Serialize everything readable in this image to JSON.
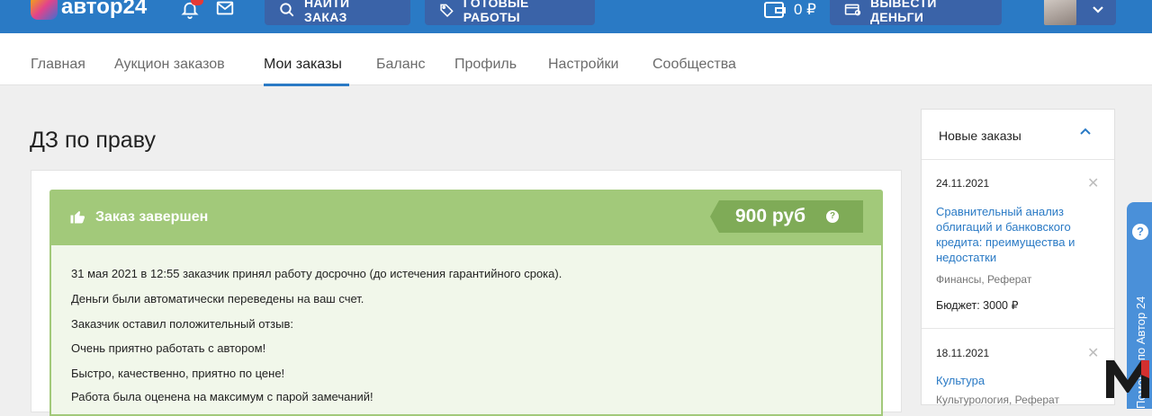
{
  "header": {
    "logo_text": "автор24",
    "find_order_label": "НАЙТИ ЗАКАЗ",
    "ready_works_label": "ГОТОВЫЕ РАБОТЫ",
    "balance": "0 ₽",
    "withdraw_label": "ВЫВЕСТИ ДЕНЬГИ",
    "brand_color": "#2a7ac5"
  },
  "nav": {
    "items": [
      "Главная",
      "Аукцион заказов",
      "Мои заказы",
      "Баланс",
      "Профиль",
      "Настройки",
      "Сообщества"
    ],
    "active": "Мои заказы"
  },
  "page": {
    "title": "ДЗ по праву"
  },
  "status": {
    "label": "Заказ завершен",
    "price": "900 руб",
    "help": "?",
    "lines": [
      "31 мая 2021 в 12:55 заказчик принял работу досрочно (до истечения гарантийного срока).",
      "Деньги были автоматически переведены на ваш счет.",
      "Заказчик оставил положительный отзыв:",
      "Очень приятно работать с автором!",
      "Быстро, качественно, приятно по цене!",
      "Работа была оценена на максимум с парой замечаний!"
    ],
    "color": "#a2c97a"
  },
  "sidebar": {
    "title": "Новые заказы",
    "orders": [
      {
        "date": "24.11.2021",
        "title": "Сравнительный анализ облигаций и банковского кредита: преимущества и недостатки",
        "meta": "Финансы, Реферат",
        "budget": "Бюджет: 3000 ₽"
      },
      {
        "date": "18.11.2021",
        "title": "Культура",
        "meta": "Культурология, Реферат"
      }
    ]
  },
  "help_tab": {
    "text": "Помощь по Автор 24",
    "icon": "?"
  }
}
